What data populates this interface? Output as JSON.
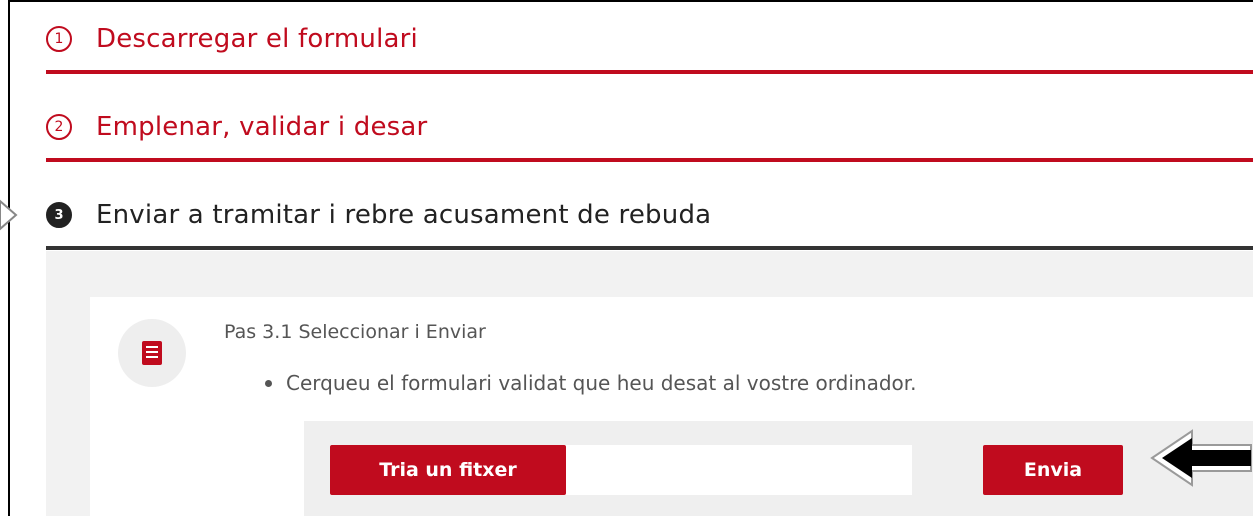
{
  "steps": [
    {
      "number": "1",
      "title": "Descarregar el formulari"
    },
    {
      "number": "2",
      "title": "Emplenar, validar i desar"
    },
    {
      "number": "3",
      "title": "Enviar a tramitar i rebre acusament de rebuda"
    }
  ],
  "panel": {
    "step_label": "Pas 3.1 Seleccionar i Enviar",
    "instruction": "Cerqueu el formulari validat que heu desat al vostre ordinador.",
    "choose_file_label": "Tria un fitxer",
    "send_label": "Envia"
  },
  "icons": {
    "document": "document-icon",
    "pointer_arrow": "arrow-left-icon",
    "partial_arrow": "arrow-right-icon"
  },
  "colors": {
    "accent": "#c00b1e",
    "active_step": "#222222",
    "panel_bg": "#f2f2f2"
  }
}
